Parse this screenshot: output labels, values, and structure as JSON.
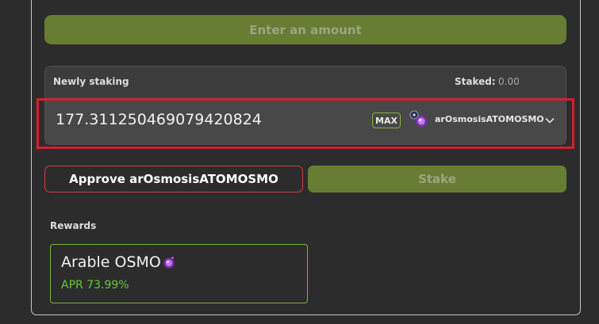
{
  "enter_amount_button": {
    "label": "Enter an amount"
  },
  "staking": {
    "newly_label": "Newly staking",
    "staked_label": "Staked:",
    "staked_value": "0.00",
    "amount_value": "177.311250469079420824",
    "max_label": "MAX",
    "token_name": "arOsmosisATOMOSMO",
    "token_icon": "atom-osmo-token-icon",
    "dropdown_icon": "chevron-down-icon"
  },
  "actions": {
    "approve_label": "Approve arOsmosisATOMOSMO",
    "stake_label": "Stake"
  },
  "rewards": {
    "label": "Rewards",
    "card": {
      "name": "Arable OSMO",
      "icon": "osmo-token-icon",
      "apr": "APR 73.99%"
    }
  },
  "colors": {
    "background": "#2c2c2c",
    "button_disabled_green": "#677d33",
    "accent_green": "#7fb33b",
    "apr_green": "#67c93a",
    "highlight_red": "#d2212d",
    "approve_border_red": "#d13a3a"
  }
}
